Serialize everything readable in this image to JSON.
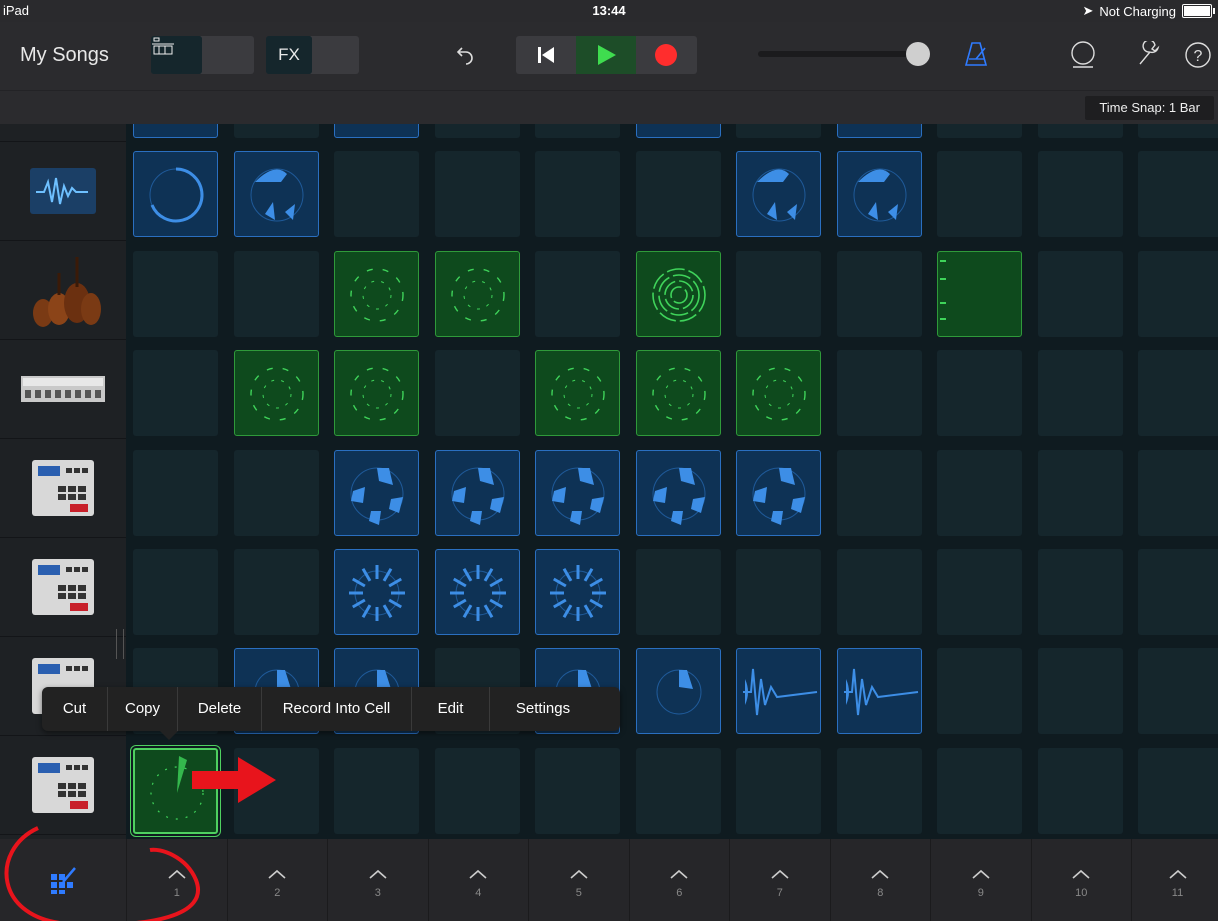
{
  "status": {
    "device": "iPad",
    "time": "13:44",
    "charging": "Not Charging"
  },
  "toolbar": {
    "my_songs": "My Songs",
    "fx_label": "FX",
    "time_snap": "Time Snap: 1 Bar",
    "accent": "#2f7bff",
    "icons": [
      "view-toggle-icon",
      "tracks-view-icon",
      "mixer-icon",
      "undo-icon",
      "rewind-icon",
      "play-icon",
      "record-icon",
      "metronome-icon",
      "loop-browser-icon",
      "settings-wrench-icon",
      "help-icon"
    ]
  },
  "instruments": [
    {
      "name": "synth-waveform-icon"
    },
    {
      "name": "strings-icon"
    },
    {
      "name": "drum-machine-icon"
    },
    {
      "name": "mpc-sampler-icon"
    },
    {
      "name": "mpc-sampler-icon"
    },
    {
      "name": "mpc-sampler-icon"
    },
    {
      "name": "mpc-sampler-icon"
    }
  ],
  "context_menu": {
    "items": [
      "Cut",
      "Copy",
      "Delete",
      "Record Into Cell",
      "Edit",
      "Settings"
    ]
  },
  "columns": [
    "1",
    "2",
    "3",
    "4",
    "5",
    "6",
    "7",
    "8",
    "9",
    "10",
    "11"
  ],
  "colors": {
    "blue_cell": "#0e3255",
    "green_cell": "#0e4a1d",
    "wave_blue": "#3d8ee6",
    "wave_green": "#3fd35a",
    "annotation": "#e8141c"
  }
}
